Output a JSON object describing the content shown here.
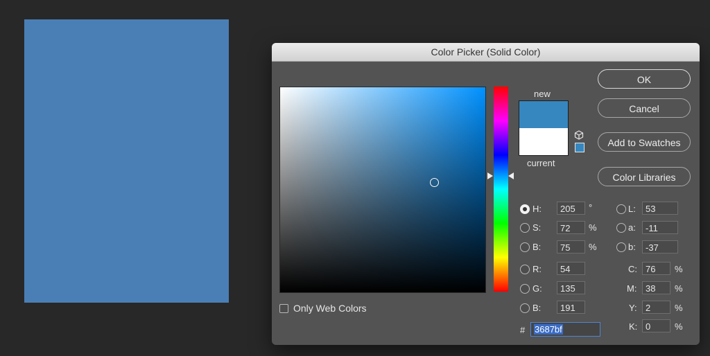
{
  "colors": {
    "current_fill": "#4a7fb6",
    "new_color": "#3687bf",
    "current_color": "#ffffff",
    "hue_pure": "#0091ff"
  },
  "dialog": {
    "title": "Color Picker (Solid Color)",
    "buttons": {
      "ok": "OK",
      "cancel": "Cancel",
      "add_to_swatches": "Add to Swatches",
      "color_libraries": "Color Libraries"
    },
    "swatch_labels": {
      "new": "new",
      "current": "current"
    },
    "only_web_colors": {
      "label": "Only Web Colors",
      "checked": false
    },
    "fields": {
      "H": {
        "label": "H:",
        "value": "205",
        "unit": "°",
        "selected": true
      },
      "S": {
        "label": "S:",
        "value": "72",
        "unit": "%",
        "selected": false
      },
      "B": {
        "label": "B:",
        "value": "75",
        "unit": "%",
        "selected": false
      },
      "R": {
        "label": "R:",
        "value": "54",
        "selected": false
      },
      "G": {
        "label": "G:",
        "value": "135",
        "selected": false
      },
      "Bl": {
        "label": "B:",
        "value": "191",
        "selected": false
      },
      "L": {
        "label": "L:",
        "value": "53",
        "selected": false
      },
      "a": {
        "label": "a:",
        "value": "-11",
        "selected": false
      },
      "b": {
        "label": "b:",
        "value": "-37",
        "selected": false
      },
      "C": {
        "label": "C:",
        "value": "76",
        "unit": "%"
      },
      "M": {
        "label": "M:",
        "value": "38",
        "unit": "%"
      },
      "Y": {
        "label": "Y:",
        "value": "2",
        "unit": "%"
      },
      "K": {
        "label": "K:",
        "value": "0",
        "unit": "%"
      }
    },
    "hex": {
      "label": "#",
      "value": "3687bf"
    },
    "icons": {
      "cube": "cube-icon",
      "websafe_swatch": "websafe-swatch-icon"
    }
  }
}
